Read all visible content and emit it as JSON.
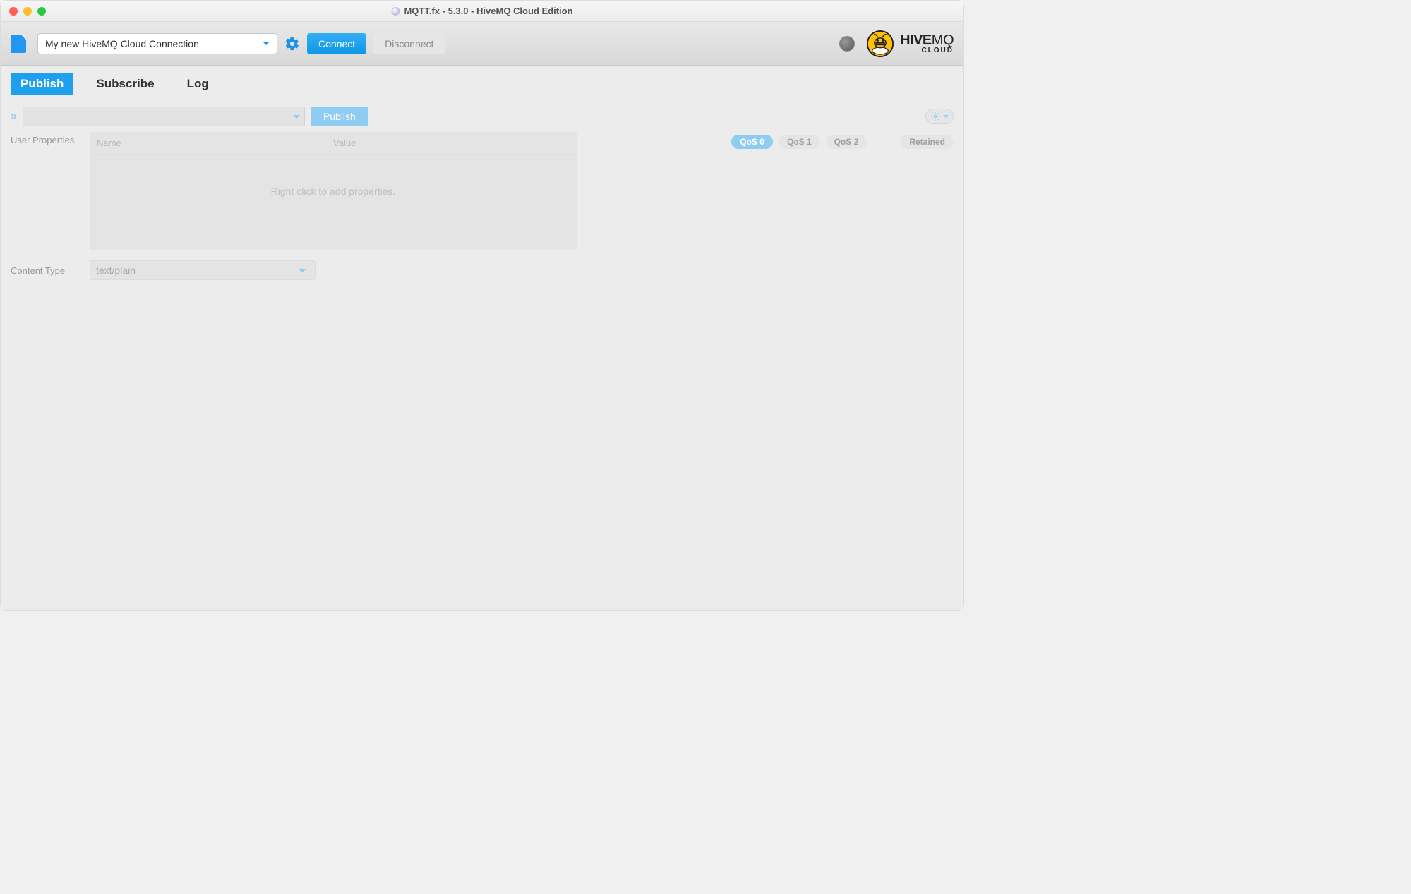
{
  "window": {
    "title": "MQTT.fx - 5.3.0 - HiveMQ Cloud Edition"
  },
  "toolbar": {
    "connection_selected": "My new HiveMQ  Cloud Connection",
    "connect_label": "Connect",
    "disconnect_label": "Disconnect"
  },
  "brand": {
    "name": "HIVE",
    "suffix": "MQ",
    "sub": "CLOUD"
  },
  "tabs": {
    "publish": "Publish",
    "subscribe": "Subscribe",
    "log": "Log",
    "active": "publish"
  },
  "publish": {
    "topic_value": "",
    "publish_label": "Publish",
    "user_properties_label": "User Properties",
    "props_columns": {
      "name": "Name",
      "value": "Value"
    },
    "props_placeholder": "Right click to add properties.",
    "qos": {
      "qos0": "QoS 0",
      "qos1": "QoS 1",
      "qos2": "QoS 2",
      "retained": "Retained",
      "selected": "qos0"
    },
    "content_type_label": "Content Type",
    "content_type_value": "text/plain"
  }
}
